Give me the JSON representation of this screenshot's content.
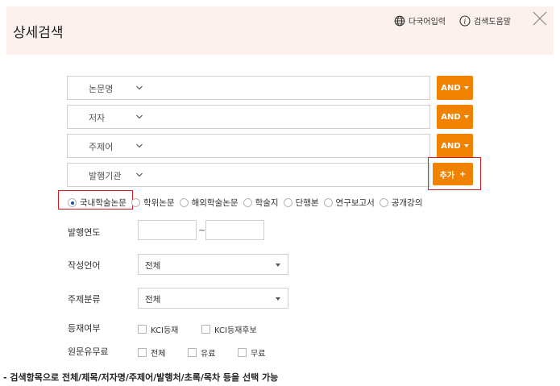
{
  "header": {
    "title": "상세검색",
    "multi_input": "다국어입력",
    "help": "검색도움말",
    "globe_icon": "globe-icon",
    "info_icon": "info-icon",
    "close_icon": "close-icon"
  },
  "fields": [
    {
      "label": "논문명",
      "operator": "AND"
    },
    {
      "label": "저자",
      "operator": "AND"
    },
    {
      "label": "주제어",
      "operator": "AND"
    },
    {
      "label": "발행기관"
    }
  ],
  "add_button": {
    "label": "추가",
    "plus": "+"
  },
  "types": {
    "selected": "국내학술논문",
    "options": [
      "국내학술논문",
      "학위논문",
      "해외학술논문",
      "학술지",
      "단행본",
      "연구보고서",
      "공개강의"
    ]
  },
  "year": {
    "label": "발행연도",
    "from": "",
    "to": "",
    "separator": "~"
  },
  "language": {
    "label": "작성언어",
    "value": "전체"
  },
  "subject": {
    "label": "주제분류",
    "value": "전체"
  },
  "listing": {
    "label": "등재여부",
    "options": [
      "KCI등재",
      "KCI등재후보"
    ]
  },
  "fee": {
    "label": "원문유무료",
    "options": [
      "전체",
      "유료",
      "무료"
    ]
  },
  "note": "- 검색항목으로 전체/제목/저자명/주제어/발행처/초록/목차 등을 선택 가능",
  "colors": {
    "accent": "#f08200",
    "highlight_border": "#d71920",
    "header_bg": "#fdf1ee"
  }
}
